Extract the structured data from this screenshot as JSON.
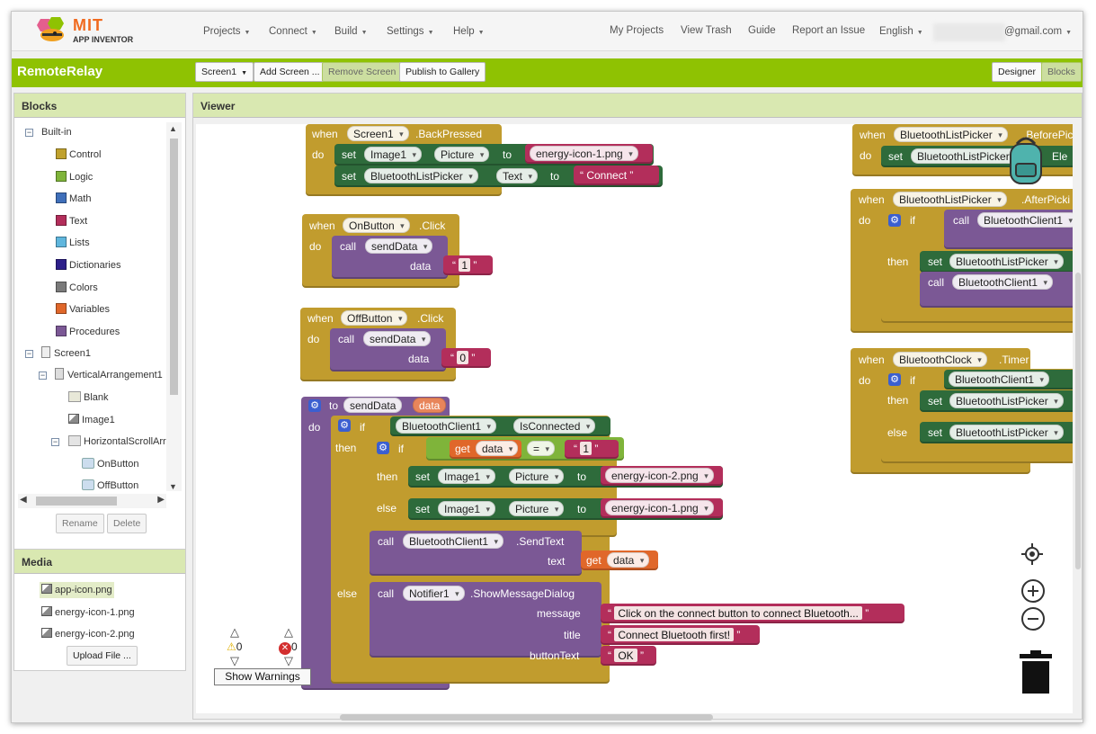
{
  "header": {
    "logo_top": "MIT",
    "logo_bottom": "APP INVENTOR",
    "menus": [
      "Projects",
      "Connect",
      "Build",
      "Settings",
      "Help"
    ],
    "links": [
      "My Projects",
      "View Trash",
      "Guide",
      "Report an Issue"
    ],
    "language": "English",
    "email": "@gmail.com"
  },
  "project": {
    "name": "RemoteRelay",
    "screen_select": "Screen1",
    "add_screen": "Add Screen ...",
    "remove_screen": "Remove Screen",
    "publish": "Publish to Gallery",
    "designer": "Designer",
    "blocks": "Blocks"
  },
  "blocks_panel": {
    "title": "Blocks",
    "builtin": "Built-in",
    "categories": [
      {
        "label": "Control",
        "color": "#c0a12d"
      },
      {
        "label": "Logic",
        "color": "#7fb43a"
      },
      {
        "label": "Math",
        "color": "#3f6fba"
      },
      {
        "label": "Text",
        "color": "#b32e5b"
      },
      {
        "label": "Lists",
        "color": "#5fb6dd"
      },
      {
        "label": "Dictionaries",
        "color": "#2d1f8a"
      },
      {
        "label": "Colors",
        "color": "#7a7a7a"
      },
      {
        "label": "Variables",
        "color": "#e0672a"
      },
      {
        "label": "Procedures",
        "color": "#7b5895"
      }
    ],
    "components": [
      "Screen1",
      "VerticalArrangement1",
      "Blank",
      "Image1",
      "HorizontalScrollArr",
      "OnButton",
      "OffButton"
    ],
    "rename": "Rename",
    "delete": "Delete"
  },
  "media_panel": {
    "title": "Media",
    "files": [
      "app-icon.png",
      "energy-icon-1.png",
      "energy-icon-2.png"
    ],
    "upload": "Upload File ..."
  },
  "viewer": {
    "title": "Viewer",
    "warnings_count": "0",
    "errors_count": "0",
    "show_warnings": "Show Warnings"
  },
  "code": {
    "when": "when",
    "do": "do",
    "set": "set",
    "to": "to",
    "call": "call",
    "if": "if",
    "then": "then",
    "else": "else",
    "get": "get",
    "data": "data",
    "text": "text",
    "eq": "=",
    "message": "message",
    "title": "title",
    "buttonText": "buttonText",
    "screen1": "Screen1",
    "back_pressed": ".BackPressed",
    "image1": "Image1",
    "picture": "Picture",
    "energy1": "energy-icon-1.png",
    "energy2": "energy-icon-2.png",
    "btlp": "BluetoothListPicker",
    "text_prop": "Text",
    "connect_str": "Connect",
    "onbutton": "OnButton",
    "offbutton": "OffButton",
    "click": ".Click",
    "senddata": "sendData",
    "one": "1",
    "zero": "0",
    "proc_to": "to",
    "btclient": "BluetoothClient1",
    "isconnected": "IsConnected",
    "sendtext": ".SendText",
    "notifier": "Notifier1",
    "showmsg": ".ShowMessageDialog",
    "msg_str": "Click on the connect button to connect Bluetooth...",
    "title_str": "Connect Bluetooth first!",
    "ok_str": "OK",
    "before_picking": ".BeforePic",
    "after_picking": ".AfterPicki",
    "ele": "Ele",
    "btclock": "BluetoothClock",
    "timer": ".Timer"
  }
}
